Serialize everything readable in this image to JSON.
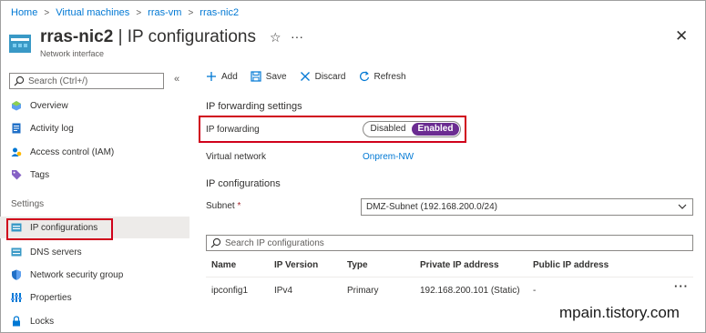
{
  "breadcrumb": [
    "Home",
    "Virtual machines",
    "rras-vm",
    "rras-nic2"
  ],
  "header": {
    "resource_name": "rras-nic2",
    "separator": "|",
    "blade_title": "IP configurations",
    "subtitle": "Network interface"
  },
  "sidebar": {
    "search_placeholder": "Search (Ctrl+/)",
    "items_top": [
      {
        "label": "Overview",
        "icon": "overview-icon"
      },
      {
        "label": "Activity log",
        "icon": "activity-log-icon"
      },
      {
        "label": "Access control (IAM)",
        "icon": "iam-icon"
      },
      {
        "label": "Tags",
        "icon": "tag-icon"
      }
    ],
    "section_label": "Settings",
    "items_settings": [
      {
        "label": "IP configurations",
        "icon": "ip-config-icon",
        "selected": true
      },
      {
        "label": "DNS servers",
        "icon": "dns-icon"
      },
      {
        "label": "Network security group",
        "icon": "shield-icon"
      },
      {
        "label": "Properties",
        "icon": "properties-icon"
      },
      {
        "label": "Locks",
        "icon": "lock-icon"
      }
    ]
  },
  "toolbar": {
    "add": "Add",
    "save": "Save",
    "discard": "Discard",
    "refresh": "Refresh"
  },
  "ip_forwarding": {
    "section_title": "IP forwarding settings",
    "label": "IP forwarding",
    "option_off": "Disabled",
    "option_on": "Enabled",
    "value": "Enabled",
    "vnet_label": "Virtual network",
    "vnet_value": "Onprem-NW"
  },
  "ip_configurations": {
    "section_title": "IP configurations",
    "subnet_label": "Subnet",
    "subnet_required_mark": "*",
    "subnet_value": "DMZ-Subnet (192.168.200.0/24)",
    "search_placeholder": "Search IP configurations",
    "columns": [
      "Name",
      "IP Version",
      "Type",
      "Private IP address",
      "Public IP address"
    ],
    "rows": [
      {
        "name": "ipconfig1",
        "version": "IPv4",
        "type": "Primary",
        "private_ip": "192.168.200.101 (Static)",
        "public_ip": "-"
      }
    ]
  },
  "watermark": "mpain.tistory.com",
  "colors": {
    "accent": "#0078d4",
    "toggle_on": "#6b2c91",
    "highlight": "#d0021b"
  }
}
